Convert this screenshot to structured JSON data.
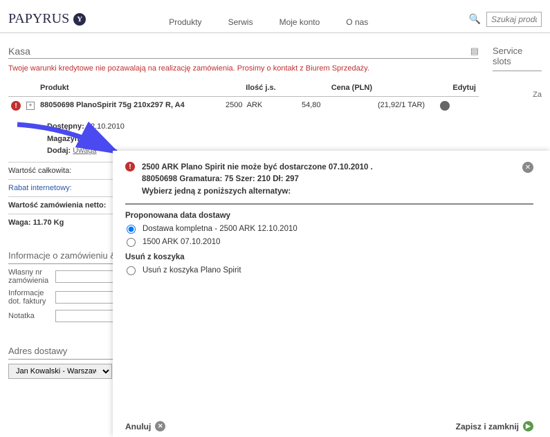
{
  "header": {
    "logo_text": "PAPYRUS",
    "nav": [
      "Produkty",
      "Serwis",
      "Moje konto",
      "O nas"
    ],
    "search_placeholder": "Szukaj produkt"
  },
  "kasa": {
    "title": "Kasa",
    "warning": "Twoje warunki kredytowe nie pozawalają na realizację zamówienia. Prosimy o kontakt z Biurem Sprzedaży.",
    "columns": {
      "produkt": "Produkt",
      "ilosc": "Ilość j.s.",
      "cena": "Cena (PLN)",
      "edytuj": "Edytuj"
    },
    "row": {
      "code": "88050698",
      "name": "PlanoSpirit 75g 210x297 R, A4",
      "qty": "2500",
      "unit": "ARK",
      "price": "54,80",
      "per": "(21,92/1 TAR)",
      "dostepny_label": "Dostępny:",
      "dostepny_value": "12.10.2010",
      "magazyn_label": "Magazyn:",
      "dodaj_label": "Dodaj:",
      "dodaj_link": "Uwaga"
    },
    "totals": {
      "wartosc_calk": "Wartość całkowita:",
      "rabat": "Rabat internetowy:",
      "wartosc_netto": "Wartość zamówienia netto:",
      "waga_label": "Waga:",
      "waga_value": "11.70 Kg"
    }
  },
  "order_info": {
    "title": "Informacje o zamówieniu &",
    "fields": {
      "wlasny": "Własny nr zamówienia",
      "faktura": "Informacje dot. faktury",
      "notatka": "Notatka"
    }
  },
  "delivery": {
    "title": "Adres dostawy",
    "selected": "Jan Kowalski - Warszawa"
  },
  "right": {
    "service_slots": "Service slots",
    "za": "Za"
  },
  "modal": {
    "line1": "2500  ARK Plano Spirit  nie może być dostarczone 07.10.2010 .",
    "line2": "88050698  Gramatura: 75  Szer: 210  Dł: 297",
    "line3": "Wybierz jedną z poniższych alternatyw:",
    "prop_title": "Proponowana data dostawy",
    "opt1": "Dostawa kompletna -  2500  ARK  12.10.2010",
    "opt2": "1500  ARK  07.10.2010",
    "remove_title": "Usuń z koszyka",
    "opt3": "Usuń z koszyka Plano Spirit",
    "cancel": "Anuluj",
    "save": "Zapisz i zamknij"
  }
}
